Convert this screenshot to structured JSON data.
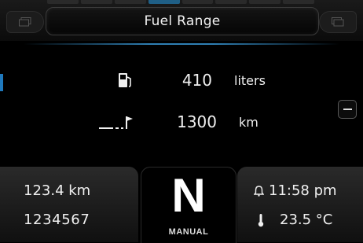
{
  "header": {
    "title": "Fuel Range"
  },
  "info": {
    "fuel": {
      "icon": "fuel-pump-icon",
      "value": "410",
      "unit": "liters"
    },
    "range": {
      "icon": "range-flag-icon",
      "value": "1300",
      "unit": "km"
    }
  },
  "status": {
    "trip": "123.4 km",
    "odometer": "1234567",
    "gear": "N",
    "transmission": "MANUAL",
    "clock": "11:58 pm",
    "temperature": "23.5 °C"
  },
  "colors": {
    "accent": "#1f79bd",
    "text": "#f0f0f0",
    "background": "#000000"
  }
}
